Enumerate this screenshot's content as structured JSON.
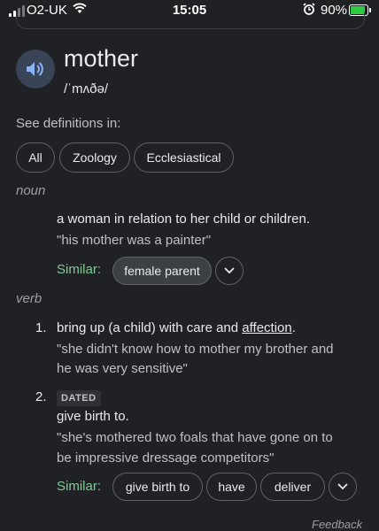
{
  "status_bar": {
    "carrier": "O2-UK",
    "time": "15:05",
    "battery_percent": "90%",
    "signal_bars_active": 2,
    "signal_bars_total": 4,
    "battery_color": "#2ecc40"
  },
  "entry": {
    "word": "mother",
    "phonetic": "/ˈmʌðə/",
    "speaker_icon": "speaker-icon"
  },
  "definitions_in": {
    "label": "See definitions in:",
    "chips": [
      "All",
      "Zoology",
      "Ecclesiastical"
    ]
  },
  "noun": {
    "pos": "noun",
    "definition": "a woman in relation to her child or children.",
    "example": "\"his mother was a painter\"",
    "similar_label": "Similar:",
    "similar": [
      "female parent"
    ]
  },
  "verb": {
    "pos": "verb",
    "senses": [
      {
        "number": "1.",
        "definition_pre": "bring up (a child) with care and ",
        "definition_link": "affection",
        "definition_post": ".",
        "example_line1": "\"she didn't know how to mother my brother and",
        "example_line2": "he was very sensitive\""
      },
      {
        "number": "2.",
        "label": "DATED",
        "definition": "give birth to.",
        "example_line1": "\"she's mothered two foals that have gone on to",
        "example_line2": "be impressive dressage competitors\"",
        "similar_label": "Similar:",
        "similar": [
          "give birth to",
          "have",
          "deliver"
        ]
      }
    ]
  },
  "footer": {
    "feedback": "Feedback"
  },
  "colors": {
    "background": "#202124",
    "similar_green": "#81c995",
    "speaker_bg": "#394457"
  }
}
